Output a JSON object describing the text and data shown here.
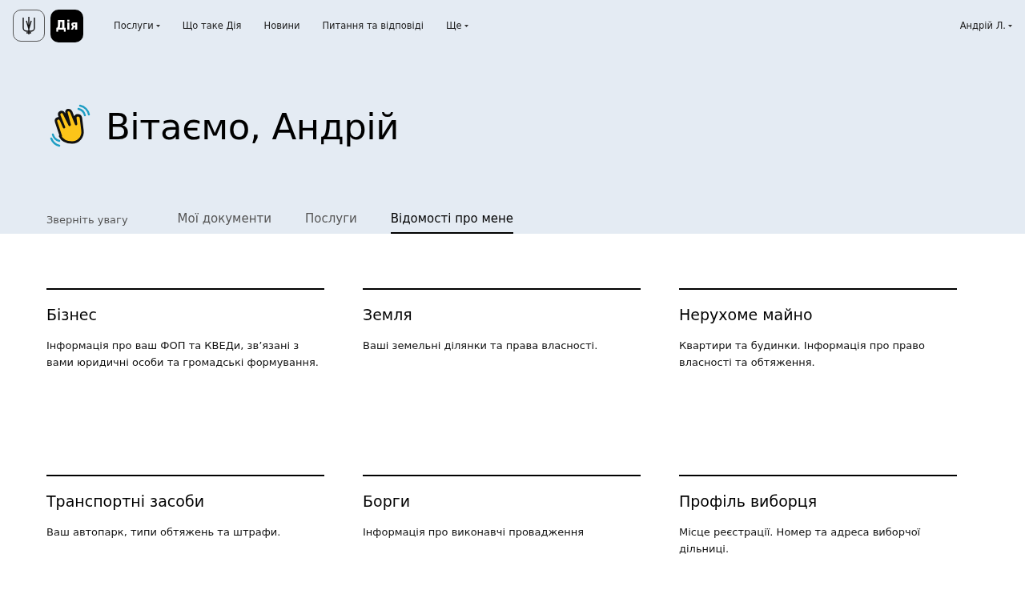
{
  "logo": {
    "text": "Дія"
  },
  "nav": [
    {
      "label": "Послуги",
      "has_menu": true
    },
    {
      "label": "Що таке Дія",
      "has_menu": false
    },
    {
      "label": "Новини",
      "has_menu": false
    },
    {
      "label": "Питання та відповіді",
      "has_menu": false
    },
    {
      "label": "Ще",
      "has_menu": true
    }
  ],
  "user": {
    "label": "Андрій Л.",
    "has_menu": true
  },
  "greeting": "Вітаємо, Андрій",
  "tabs": [
    {
      "label": "Зверніть увагу",
      "selected": false,
      "kind": "small"
    },
    {
      "label": "Мої документи",
      "selected": false,
      "kind": "normal"
    },
    {
      "label": "Послуги",
      "selected": false,
      "kind": "normal"
    },
    {
      "label": "Відомості про мене",
      "selected": true,
      "kind": "normal"
    }
  ],
  "cards": [
    {
      "title": "Бізнес",
      "description": "Інформація про ваш ФОП та КВЕДи, зв’язані з вами юридичні особи та громадські формування."
    },
    {
      "title": "Земля",
      "description": "Ваші земельні ділянки та права власності."
    },
    {
      "title": "Нерухоме майно",
      "description": "Квартири та будинки. Інформація про право власності та обтяження."
    },
    {
      "title": "Транспортні засоби",
      "description": "Ваш автопарк, типи обтяжень та штрафи."
    },
    {
      "title": "Борги",
      "description": "Інформація про виконавчі провадження"
    },
    {
      "title": "Профіль виборця",
      "description": "Місце реєстрації. Номер та адреса виборчої дільниці."
    }
  ]
}
